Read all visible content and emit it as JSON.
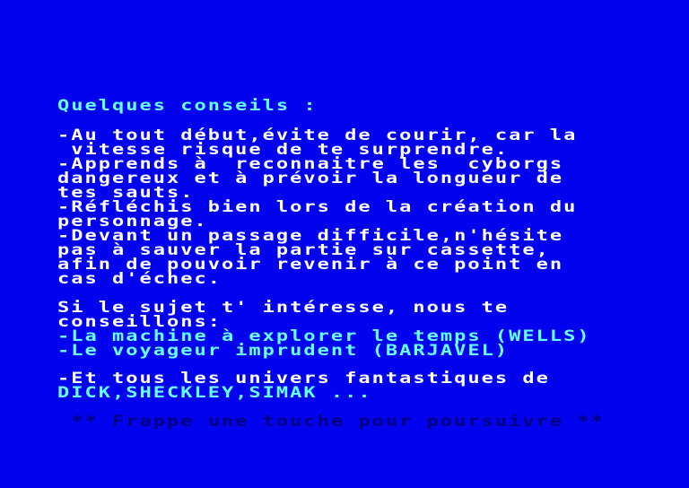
{
  "screen": {
    "title": "Quelques conseils :",
    "advice": [
      "-Au tout début,évite de courir, car la",
      " vitesse risque de te surprendre.",
      "-Apprends à  reconnaitre les  cyborgs",
      "dangereux et à prévoir la longueur de",
      "tes sauts.",
      "-Réfléchis bien lors de la création du",
      "personnage.",
      "-Devant un passage difficile,n'hésite",
      "pas à sauver la partie sur cassette,",
      "afin de pouvoir revenir à ce point en",
      "cas d'échec."
    ],
    "interest": [
      "Si le sujet t' intéresse, nous te",
      "conseillons:"
    ],
    "books": [
      "-La machine à explorer le temps (WELLS)",
      "-Le voyageur imprudent (BARJAVEL)"
    ],
    "universe_intro": "-Et tous les univers fantastiques de",
    "authors": "DICK,SHECKLEY,SIMAK ...",
    "prompt": " ** Frappe une touche pour poursuivre **"
  },
  "colors": {
    "background": "#0202ee",
    "title_text": "#66ffff",
    "body_text": "#ffffff",
    "prompt_text": "#000080"
  }
}
